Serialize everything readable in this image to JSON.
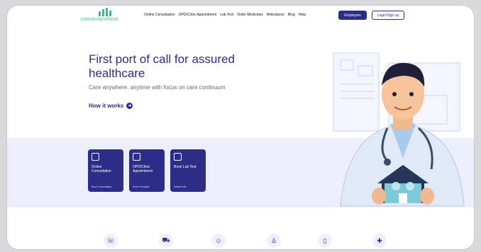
{
  "nav": {
    "logo_text": "connectandheal",
    "menu": [
      "Online Consultation",
      "OPD/Clinic Appointment",
      "Lab Test",
      "Order Medicines",
      "Ambulance",
      "Blog",
      "Help"
    ],
    "employers_label": "Employers",
    "login_label": "Login/Sign up"
  },
  "hero": {
    "title": "First port of call for assured healthcare",
    "subtitle": "Care anywhere, anytime with focus on care continuum",
    "cta": "How it works"
  },
  "cards": [
    {
      "title": "Online Consultation",
      "sub": "Book Consultation"
    },
    {
      "title": "OPD/Clinic Appointment",
      "sub": "Find a Hospital"
    },
    {
      "title": "Book Lab Test",
      "sub": "Instant Lab"
    }
  ],
  "bottom_icons": [
    "phone-icon",
    "ambulance-icon",
    "doctor-icon",
    "person-icon",
    "mobile-icon",
    "medicine-icon"
  ],
  "colors": {
    "brand": "#2b2d86",
    "accent": "#48b59b",
    "band": "#eceefb"
  }
}
